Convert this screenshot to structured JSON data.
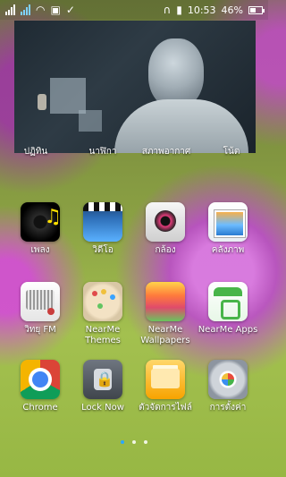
{
  "status_bar": {
    "time": "10:53",
    "battery_percent": "46%",
    "battery_level": 0.46,
    "left_icons": [
      "signal-sim1-icon",
      "signal-sim2-icon",
      "wifi-icon",
      "image-notification-icon",
      "clipboard-check-icon"
    ],
    "right_icons": [
      "headset-icon",
      "vibrate-icon",
      "battery-icon"
    ]
  },
  "top_row_labels": [
    {
      "label": "ปฏิทิน"
    },
    {
      "label": "นาฬิกา"
    },
    {
      "label": "สภาพอากาศ"
    },
    {
      "label": "โน้ต"
    }
  ],
  "apps": [
    {
      "label": "เพลง",
      "icon": "music-icon"
    },
    {
      "label": "วิดีโอ",
      "icon": "video-icon"
    },
    {
      "label": "กล้อง",
      "icon": "camera-icon"
    },
    {
      "label": "คลังภาพ",
      "icon": "gallery-icon"
    },
    {
      "label": "วิทยุ FM",
      "icon": "radio-icon"
    },
    {
      "label": "NearMe Themes",
      "icon": "themes-icon"
    },
    {
      "label": "NearMe Wallpapers",
      "icon": "wallpapers-icon"
    },
    {
      "label": "NearMe Apps",
      "icon": "nearme-apps-icon"
    },
    {
      "label": "Chrome",
      "icon": "chrome-icon"
    },
    {
      "label": "Lock Now",
      "icon": "lock-icon"
    },
    {
      "label": "ตัวจัดการไฟล์",
      "icon": "files-icon"
    },
    {
      "label": "การตั้งค่า",
      "icon": "settings-icon"
    }
  ],
  "page_indicator": {
    "count": 3,
    "active_index": 0
  }
}
